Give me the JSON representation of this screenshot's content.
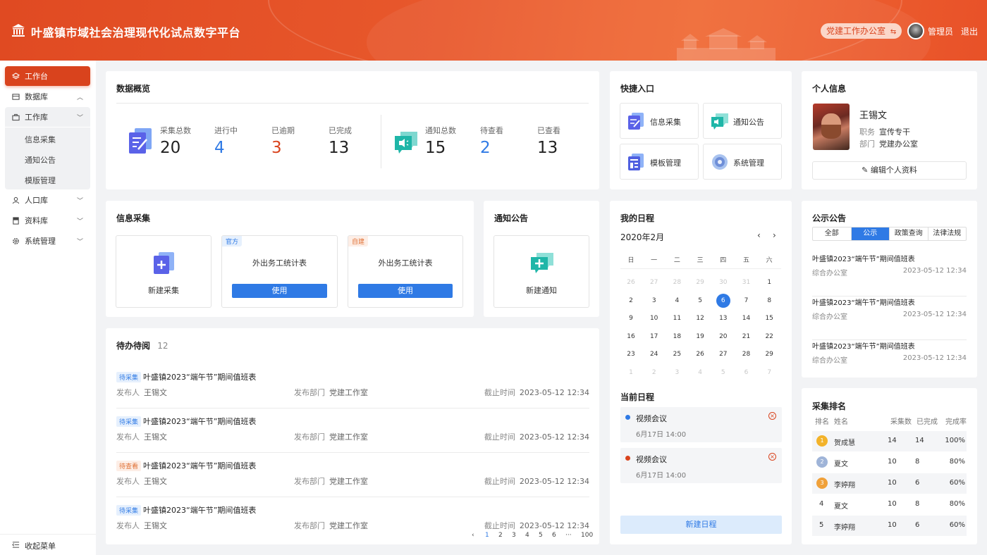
{
  "header": {
    "title": "叶盛镇市域社会治理现代化试点数字平台",
    "office": "党建工作办公室",
    "office_icon": "switch-icon",
    "user": "管理员",
    "logout": "退出",
    "brand_color": "#e04a22"
  },
  "sidebar": {
    "items": [
      {
        "label": "工作台",
        "icon": "layers-icon"
      },
      {
        "label": "数据库",
        "icon": "database-icon"
      },
      {
        "label": "工作库",
        "icon": "briefcase-icon"
      },
      {
        "label": "人口库",
        "icon": "person-icon"
      },
      {
        "label": "资料库",
        "icon": "book-icon"
      },
      {
        "label": "系统管理",
        "icon": "gear-icon"
      }
    ],
    "sub_items": [
      "信息采集",
      "通知公告",
      "模版管理"
    ],
    "collapse": "收起菜单"
  },
  "overview": {
    "title": "数据概览",
    "collect": [
      {
        "label": "采集总数",
        "value": "20"
      },
      {
        "label": "进行中",
        "value": "4"
      },
      {
        "label": "已逾期",
        "value": "3"
      },
      {
        "label": "已完成",
        "value": "13"
      }
    ],
    "notice": [
      {
        "label": "通知总数",
        "value": "15"
      },
      {
        "label": "待查看",
        "value": "2"
      },
      {
        "label": "已查看",
        "value": "13"
      }
    ]
  },
  "quick": {
    "title": "快捷入口",
    "items": [
      "信息采集",
      "通知公告",
      "模板管理",
      "系统管理"
    ]
  },
  "profile": {
    "title": "个人信息",
    "name": "王锡文",
    "post_label": "职务",
    "post": "宣传专干",
    "dept_label": "部门",
    "dept": "党建办公室",
    "edit": "编辑个人资料"
  },
  "collect": {
    "title": "信息采集",
    "new_label": "新建采集",
    "templates": [
      {
        "tag": "官方",
        "name": "外出务工统计表",
        "button": "使用"
      },
      {
        "tag": "自建",
        "name": "外出务工统计表",
        "button": "使用"
      }
    ]
  },
  "notice_card": {
    "title": "通知公告",
    "new_label": "新建通知"
  },
  "todo": {
    "title": "待办待阅",
    "count": "12",
    "items": [
      {
        "tag": "待采集",
        "title": "叶盛镇2023“端午节”期间值班表",
        "publisher_label": "发布人",
        "publisher": "王锡文",
        "dept_label": "发布部门",
        "dept": "党建工作室",
        "deadline_label": "截止时间",
        "deadline": "2023-05-12 12:34"
      },
      {
        "tag": "待采集",
        "title": "叶盛镇2023“端午节”期间值班表",
        "publisher_label": "发布人",
        "publisher": "王锡文",
        "dept_label": "发布部门",
        "dept": "党建工作室",
        "deadline_label": "截止时间",
        "deadline": "2023-05-12 12:34"
      },
      {
        "tag": "待查看",
        "title": "叶盛镇2023“端午节”期间值班表",
        "publisher_label": "发布人",
        "publisher": "王锡文",
        "dept_label": "发布部门",
        "dept": "党建工作室",
        "deadline_label": "截止时间",
        "deadline": "2023-05-12 12:34"
      },
      {
        "tag": "待采集",
        "title": "叶盛镇2023“端午节”期间值班表",
        "publisher_label": "发布人",
        "publisher": "王锡文",
        "dept_label": "发布部门",
        "dept": "党建工作室",
        "deadline_label": "截止时间",
        "deadline": "2023-05-12 12:34"
      }
    ],
    "pager": [
      "‹",
      "1",
      "2",
      "3",
      "4",
      "5",
      "6",
      "···",
      "100"
    ],
    "current_page": "1"
  },
  "calendar": {
    "title": "我的日程",
    "month": "2020年2月",
    "prev": "‹",
    "next": "›",
    "weekdays": [
      "日",
      "一",
      "二",
      "三",
      "四",
      "五",
      "六"
    ],
    "weeks": [
      [
        "26",
        "27",
        "28",
        "29",
        "30",
        "31",
        "1"
      ],
      [
        "2",
        "3",
        "4",
        "5",
        "6",
        "7",
        "8"
      ],
      [
        "9",
        "10",
        "11",
        "12",
        "13",
        "14",
        "15"
      ],
      [
        "16",
        "17",
        "18",
        "19",
        "20",
        "21",
        "22"
      ],
      [
        "23",
        "24",
        "25",
        "26",
        "27",
        "28",
        "29"
      ],
      [
        "1",
        "2",
        "3",
        "4",
        "5",
        "6",
        "7"
      ]
    ],
    "selected": "6",
    "current_title": "当前日程",
    "events": [
      {
        "title": "视频会议",
        "time": "6月17日 14:00",
        "color": "#2f7ae5"
      },
      {
        "title": "视频会议",
        "time": "6月17日 14:00",
        "color": "#d9431d"
      }
    ],
    "new_button": "新建日程"
  },
  "announcements": {
    "title": "公示公告",
    "tabs": [
      "全部",
      "公示",
      "政策查询",
      "法律法规"
    ],
    "active_tab": "公示",
    "items": [
      {
        "title": "叶盛镇2023“端午节”期间值班表",
        "dept": "综合办公室",
        "time": "2023-05-12 12:34"
      },
      {
        "title": "叶盛镇2023“端午节”期间值班表",
        "dept": "综合办公室",
        "time": "2023-05-12 12:34"
      },
      {
        "title": "叶盛镇2023“端午节”期间值班表",
        "dept": "综合办公室",
        "time": "2023-05-12 12:34"
      }
    ]
  },
  "ranking": {
    "title": "采集排名",
    "headers": [
      "排名",
      "姓名",
      "采集数",
      "已完成",
      "完成率"
    ],
    "rows": [
      {
        "rank": "1",
        "name": "贺成慧",
        "count": "14",
        "done": "14",
        "rate": "100%"
      },
      {
        "rank": "2",
        "name": "夏文",
        "count": "10",
        "done": "8",
        "rate": "80%"
      },
      {
        "rank": "3",
        "name": "李婷翔",
        "count": "10",
        "done": "6",
        "rate": "60%"
      },
      {
        "rank": "4",
        "name": "夏文",
        "count": "10",
        "done": "8",
        "rate": "80%"
      },
      {
        "rank": "5",
        "name": "李婷翔",
        "count": "10",
        "done": "6",
        "rate": "60%"
      }
    ]
  }
}
